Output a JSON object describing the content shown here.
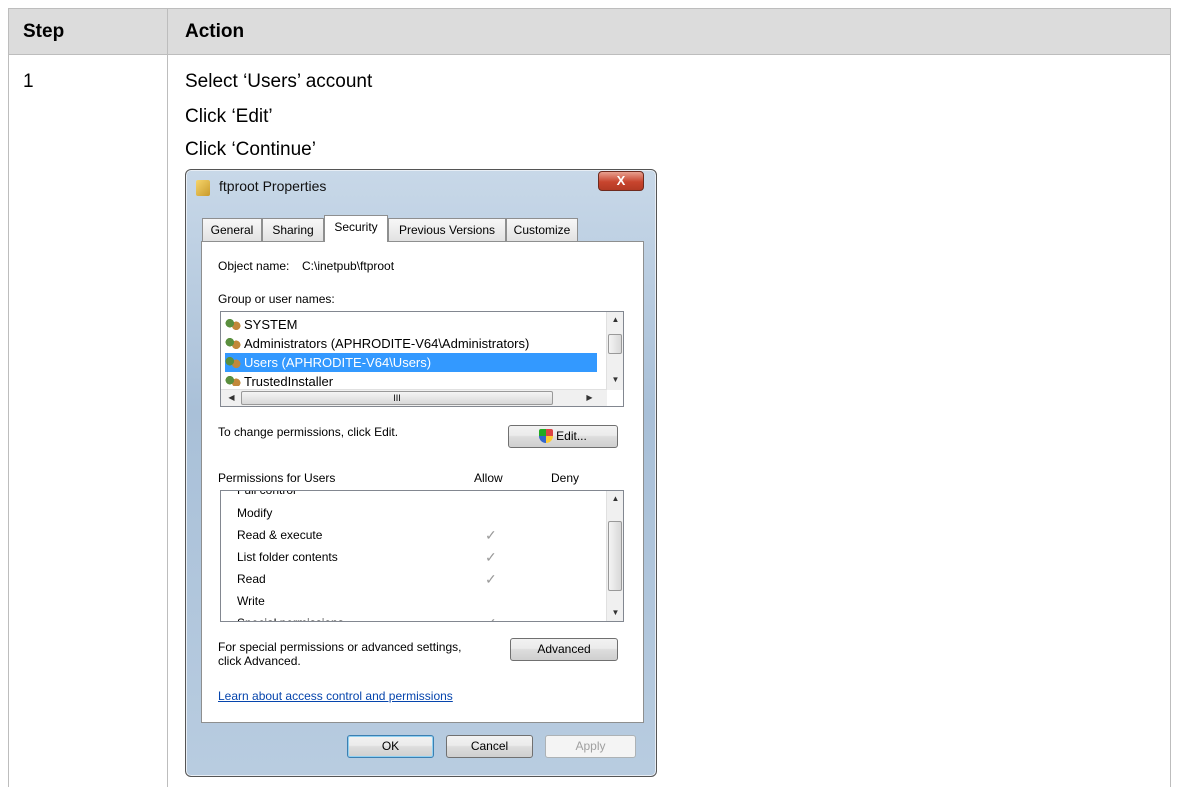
{
  "table": {
    "header_step": "Step",
    "header_action": "Action",
    "step_number": "1",
    "instructions": [
      "Select ‘Users’ account",
      "Click ‘Edit’",
      "Click ‘Continue’"
    ]
  },
  "dialog": {
    "title": "ftproot Properties",
    "close_glyph": "X",
    "tabs": [
      "General",
      "Sharing",
      "Security",
      "Previous Versions",
      "Customize"
    ],
    "active_tab": "Security",
    "object_name_label": "Object name:",
    "object_name_value": "C:\\inetpub\\ftproot",
    "group_label": "Group or user names:",
    "users": [
      "SYSTEM",
      "Administrators (APHRODITE-V64\\Administrators)",
      "Users (APHRODITE-V64\\Users)",
      "TrustedInstaller"
    ],
    "selected_user_index": 2,
    "change_hint": "To change permissions, click Edit.",
    "edit_button": "Edit...",
    "permissions_label": "Permissions for Users",
    "allow_label": "Allow",
    "deny_label": "Deny",
    "permissions": [
      {
        "name": "Full control",
        "allow": false
      },
      {
        "name": "Modify",
        "allow": false
      },
      {
        "name": "Read & execute",
        "allow": true
      },
      {
        "name": "List folder contents",
        "allow": true
      },
      {
        "name": "Read",
        "allow": true
      },
      {
        "name": "Write",
        "allow": false
      },
      {
        "name": "Special permissions",
        "allow": false
      }
    ],
    "check_glyph": "✓",
    "special_hint_line1": "For special permissions or advanced settings,",
    "special_hint_line2": "click Advanced.",
    "advanced_button": "Advanced",
    "learn_link": "Learn about access control and permissions",
    "ok_button": "OK",
    "cancel_button": "Cancel",
    "apply_button": "Apply",
    "hscroll_grip": "III"
  },
  "colors": {
    "header_bg": "#dcdcdc",
    "selection": "#3399ff",
    "link": "#0645ad"
  }
}
